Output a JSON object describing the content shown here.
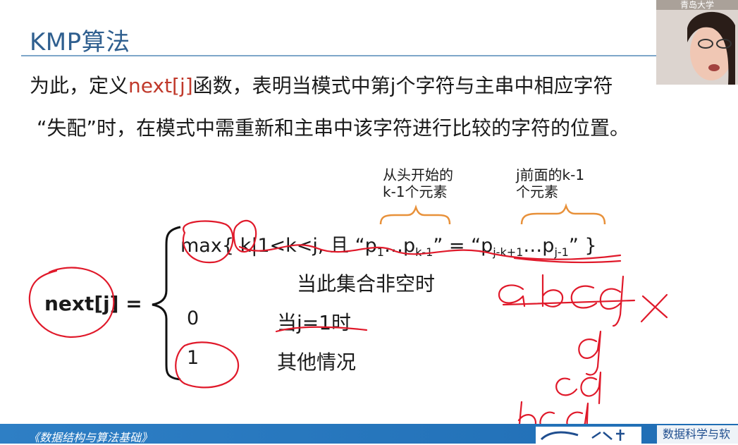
{
  "slide": {
    "title": "KMP算法",
    "intro": {
      "line1_before": "为此，定义",
      "line1_highlight": "next[j]",
      "line1_after": "函数，表明当模式中第j个字符与主串中相应字符",
      "line2": "“失配”时，在模式中需重新和主串中该字符进行比较的字符的位置。"
    },
    "formula": {
      "lhs": "next[j] =",
      "annotation_left": [
        "从头开始的",
        "k-1个元素"
      ],
      "annotation_right": [
        "j前面的k-1",
        "个元素"
      ],
      "case1_part1": "max{ k|1<k<j, 且 “p",
      "case1_sub1": "1",
      "case1_part2": "…p",
      "case1_sub2": "k-1",
      "case1_part3": "”  =  “p",
      "case1_sub3": "j-k+1",
      "case1_part4": "…p",
      "case1_sub4": "j-1",
      "case1_part5": "”  }",
      "case1_condition": "当此集合非空时",
      "case2_value": "0",
      "case2_condition": "当j=1时",
      "case3_value": "1",
      "case3_condition": "其他情况"
    },
    "footer": {
      "book": "《数据结构与算法基础》",
      "school_short": "数据科学与软"
    },
    "presenter_caption": "青岛大学"
  },
  "colors": {
    "title": "#2f5f8f",
    "highlight": "#c0392b",
    "ink": "#e0192a",
    "brace": "#e8913a",
    "footer": "#2e7fc5"
  }
}
